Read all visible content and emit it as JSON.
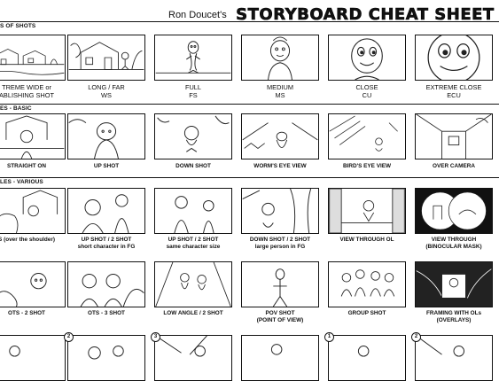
{
  "header": {
    "author": "Ron Doucet's",
    "title": "STORYBOARD CHEAT SHEET"
  },
  "sections": [
    {
      "label": "S OF SHOTS"
    },
    {
      "label": "ES - BASIC"
    },
    {
      "label": "LES - VARIOUS"
    }
  ],
  "rows": [
    {
      "panels": [
        {
          "caption": [
            "TREME WIDE or",
            "ABLISHING SHOT"
          ]
        },
        {
          "caption": [
            "LONG / FAR",
            "WS"
          ]
        },
        {
          "caption": [
            "FULL",
            "FS"
          ]
        },
        {
          "caption": [
            "MEDIUM",
            "MS"
          ]
        },
        {
          "caption": [
            "CLOSE",
            "CU"
          ]
        },
        {
          "caption": [
            "EXTREME CLOSE",
            "ECU"
          ]
        }
      ]
    },
    {
      "panels": [
        {
          "caption": [
            "STRAIGHT ON"
          ]
        },
        {
          "caption": [
            "UP SHOT"
          ]
        },
        {
          "caption": [
            "DOWN SHOT"
          ]
        },
        {
          "caption": [
            "WORM'S EYE VIEW"
          ]
        },
        {
          "caption": [
            "BIRD'S EYE VIEW"
          ]
        },
        {
          "caption": [
            "OVER CAMERA"
          ]
        }
      ]
    },
    {
      "panels": [
        {
          "caption": [
            "S (over the shoulder)"
          ]
        },
        {
          "caption": [
            "UP SHOT / 2 SHOT",
            "short character in FG"
          ]
        },
        {
          "caption": [
            "UP SHOT / 2 SHOT",
            "same character size"
          ]
        },
        {
          "caption": [
            "DOWN SHOT / 2 SHOT",
            "large person in FG"
          ]
        },
        {
          "caption": [
            "VIEW THROUGH OL"
          ]
        },
        {
          "caption": [
            "VIEW THROUGH",
            "(BINOCULAR MASK)"
          ]
        }
      ]
    },
    {
      "panels": [
        {
          "caption": [
            "OTS - 2 SHOT"
          ]
        },
        {
          "caption": [
            "OTS - 3 SHOT"
          ]
        },
        {
          "caption": [
            "LOW ANGLE / 2 SHOT"
          ]
        },
        {
          "caption": [
            "POV SHOT",
            "(POINT OF VIEW)"
          ]
        },
        {
          "caption": [
            "GROUP SHOT"
          ]
        },
        {
          "caption": [
            "FRAMING WITH OLs",
            "(OVERLAYS)"
          ]
        }
      ]
    }
  ],
  "bottom_numbers": [
    "2",
    "3",
    "1",
    "2"
  ]
}
